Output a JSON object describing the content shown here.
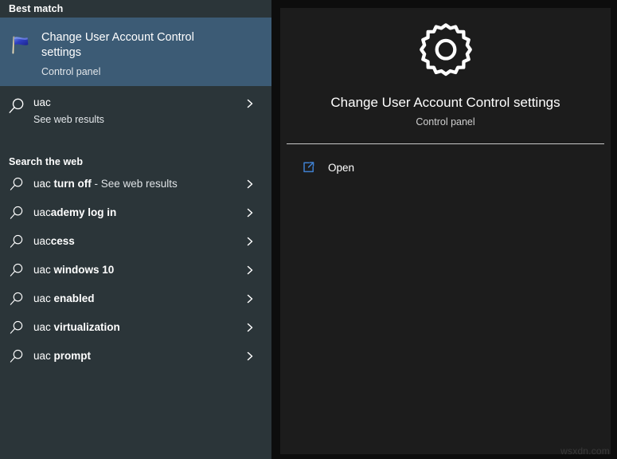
{
  "left_panel": {
    "best_match_header": "Best match",
    "best_match": {
      "icon": "uac-flag-icon",
      "title": "Change User Account Control settings",
      "subtitle": "Control panel"
    },
    "query_row": {
      "icon": "search-icon",
      "label": "uac",
      "subtitle": "See web results",
      "chevron": "chevron-right-icon"
    },
    "search_web_header": "Search the web",
    "web_results": [
      {
        "icon": "search-icon",
        "prefix": "uac",
        "bold": " turn off",
        "suffix": " - See web results",
        "chevron": "chevron-right-icon"
      },
      {
        "icon": "search-icon",
        "prefix": "uac",
        "bold": "ademy log in",
        "suffix": "",
        "chevron": "chevron-right-icon"
      },
      {
        "icon": "search-icon",
        "prefix": "uac",
        "bold": "cess",
        "suffix": "",
        "chevron": "chevron-right-icon"
      },
      {
        "icon": "search-icon",
        "prefix": "uac",
        "bold": " windows 10",
        "suffix": "",
        "chevron": "chevron-right-icon"
      },
      {
        "icon": "search-icon",
        "prefix": "uac",
        "bold": " enabled",
        "suffix": "",
        "chevron": "chevron-right-icon"
      },
      {
        "icon": "search-icon",
        "prefix": "uac",
        "bold": " virtualization",
        "suffix": "",
        "chevron": "chevron-right-icon"
      },
      {
        "icon": "search-icon",
        "prefix": "uac",
        "bold": " prompt",
        "suffix": "",
        "chevron": "chevron-right-icon"
      }
    ]
  },
  "right_panel": {
    "hero_icon": "gear-icon",
    "title": "Change User Account Control settings",
    "subtitle": "Control panel",
    "actions": [
      {
        "icon": "open-external-icon",
        "label": "Open"
      }
    ]
  },
  "watermark": "wsxdn.com",
  "colors": {
    "left_panel_bg": "#2b3539",
    "right_panel_bg": "#1c1c1c",
    "selection_blue": "#3c5b75",
    "accent_blue": "#4a7ebb",
    "page_bg": "#0d0d0d",
    "divider": "#c8c8c8"
  }
}
